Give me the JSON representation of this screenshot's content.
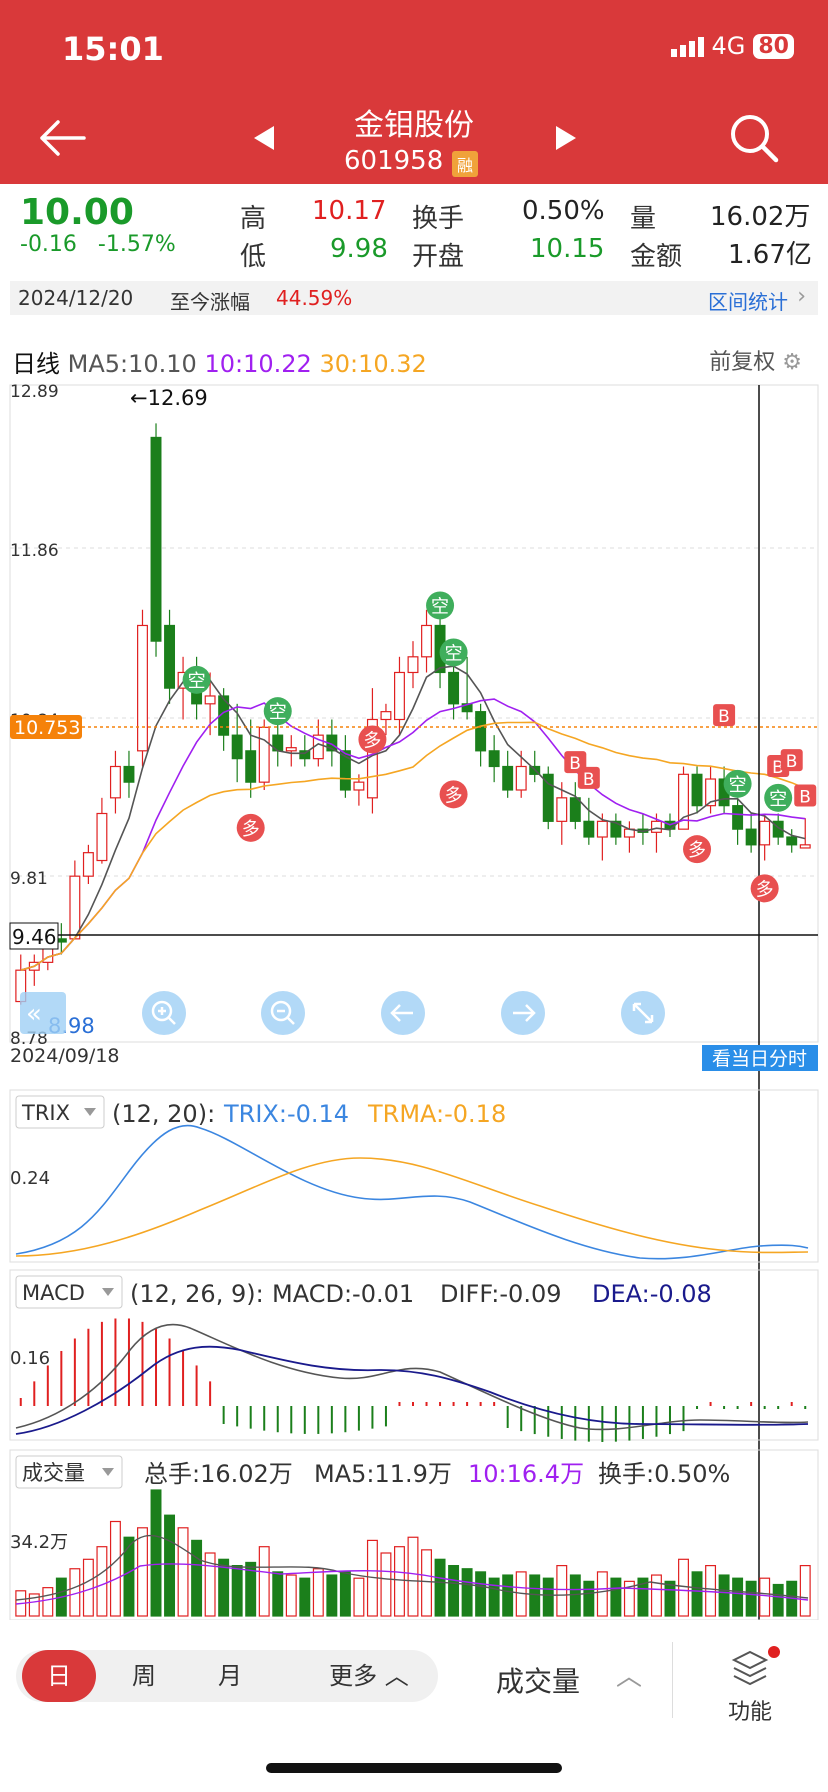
{
  "status": {
    "time": "15:01",
    "network": "4G",
    "battery": "80"
  },
  "header": {
    "name": "金钼股份",
    "code": "601958",
    "rong": "融"
  },
  "quote": {
    "price": "10.00",
    "change": "-0.16",
    "change_pct": "-1.57%",
    "high_label": "高",
    "high": "10.17",
    "low_label": "低",
    "low": "9.98",
    "turnover_label": "换手",
    "turnover": "0.50%",
    "open_label": "开盘",
    "open": "10.15",
    "vol_label": "量",
    "vol": "16.02万",
    "amount_label": "金额",
    "amount": "1.67亿"
  },
  "datebar": {
    "date": "2024/12/20",
    "since_label": "至今涨幅",
    "since_value": "44.59%",
    "range_stats": "区间统计"
  },
  "kline": {
    "title": "日线",
    "ma5": "MA5:10.10",
    "ma10": "10:10.22",
    "ma30": "30:10.32",
    "fq_label": "前复权",
    "y_labels": [
      "12.89",
      "11.86",
      "10.84",
      "9.81",
      "8.78"
    ],
    "price_tag": "10.753",
    "cross_tag": "9.46",
    "max_label": "←12.69",
    "min_label": "8.98",
    "start_date": "2024/09/18",
    "fenshi_button": "看当日分时",
    "marker_kong": "空",
    "marker_duo": "多",
    "marker_b": "B"
  },
  "trix": {
    "name": "TRIX",
    "params": "(12, 20):",
    "trix": "TRIX:-0.14",
    "trma": "TRMA:-0.18",
    "y_label": "0.24"
  },
  "macd": {
    "name": "MACD",
    "params": "(12, 26, 9):",
    "macd": "MACD:-0.01",
    "diff": "DIFF:-0.09",
    "dea": "DEA:-0.08",
    "y_label": "0.16"
  },
  "volume": {
    "name": "成交量",
    "total": "总手:16.02万",
    "ma5": "MA5:11.9万",
    "ma10": "10:16.4万",
    "turnover": "换手:0.50%",
    "y_label": "34.2万"
  },
  "colors": {
    "up": "#e02020",
    "down": "#1b7f1b",
    "ma5": "#555555",
    "ma10": "#a020f0",
    "ma30": "#f5a623",
    "brand": "#d9393a"
  },
  "chart_data": {
    "type": "candlestick",
    "x_range": [
      "2024/09/18",
      "2024/12/20"
    ],
    "ylim": [
      8.78,
      12.89
    ],
    "ohlc": [
      [
        9.0,
        9.3,
        8.98,
        9.2
      ],
      [
        9.2,
        9.3,
        9.1,
        9.25
      ],
      [
        9.25,
        9.5,
        9.2,
        9.4
      ],
      [
        9.4,
        9.5,
        9.3,
        9.38
      ],
      [
        9.4,
        9.9,
        9.4,
        9.8
      ],
      [
        9.8,
        10.0,
        9.75,
        9.95
      ],
      [
        9.9,
        10.3,
        9.88,
        10.2
      ],
      [
        10.3,
        10.6,
        10.2,
        10.5
      ],
      [
        10.5,
        10.6,
        10.3,
        10.4
      ],
      [
        10.6,
        11.5,
        10.5,
        11.4
      ],
      [
        12.6,
        12.69,
        11.2,
        11.3
      ],
      [
        11.4,
        11.5,
        10.9,
        11.0
      ],
      [
        11.0,
        11.2,
        10.8,
        11.1
      ],
      [
        11.1,
        11.2,
        10.8,
        10.9
      ],
      [
        10.9,
        11.1,
        10.7,
        10.95
      ],
      [
        10.95,
        11.0,
        10.6,
        10.7
      ],
      [
        10.7,
        10.9,
        10.4,
        10.55
      ],
      [
        10.6,
        10.8,
        10.3,
        10.4
      ],
      [
        10.4,
        10.8,
        10.35,
        10.75
      ],
      [
        10.7,
        10.8,
        10.5,
        10.6
      ],
      [
        10.6,
        10.7,
        10.5,
        10.62
      ],
      [
        10.6,
        10.7,
        10.5,
        10.55
      ],
      [
        10.55,
        10.8,
        10.5,
        10.7
      ],
      [
        10.7,
        10.8,
        10.5,
        10.6
      ],
      [
        10.6,
        10.7,
        10.3,
        10.35
      ],
      [
        10.35,
        10.45,
        10.25,
        10.4
      ],
      [
        10.3,
        11.0,
        10.2,
        10.8
      ],
      [
        10.8,
        10.9,
        10.7,
        10.85
      ],
      [
        10.8,
        11.2,
        10.7,
        11.1
      ],
      [
        11.1,
        11.3,
        11.0,
        11.2
      ],
      [
        11.2,
        11.5,
        11.1,
        11.4
      ],
      [
        11.4,
        11.5,
        11.0,
        11.1
      ],
      [
        11.1,
        11.2,
        10.8,
        10.9
      ],
      [
        10.9,
        11.2,
        10.8,
        10.85
      ],
      [
        10.85,
        10.9,
        10.5,
        10.6
      ],
      [
        10.6,
        10.7,
        10.4,
        10.5
      ],
      [
        10.5,
        10.6,
        10.3,
        10.35
      ],
      [
        10.35,
        10.6,
        10.3,
        10.5
      ],
      [
        10.5,
        10.6,
        10.4,
        10.45
      ],
      [
        10.45,
        10.5,
        10.1,
        10.15
      ],
      [
        10.15,
        10.4,
        10.0,
        10.3
      ],
      [
        10.3,
        10.4,
        10.1,
        10.15
      ],
      [
        10.15,
        10.3,
        10.0,
        10.05
      ],
      [
        10.05,
        10.2,
        9.9,
        10.15
      ],
      [
        10.15,
        10.2,
        10.0,
        10.05
      ],
      [
        10.05,
        10.15,
        9.95,
        10.1
      ],
      [
        10.1,
        10.2,
        10.0,
        10.08
      ],
      [
        10.08,
        10.2,
        9.95,
        10.15
      ],
      [
        10.15,
        10.2,
        10.05,
        10.1
      ],
      [
        10.1,
        10.5,
        10.1,
        10.45
      ],
      [
        10.45,
        10.5,
        10.2,
        10.25
      ],
      [
        10.25,
        10.5,
        10.2,
        10.42
      ],
      [
        10.42,
        10.5,
        10.2,
        10.25
      ],
      [
        10.25,
        10.3,
        10.0,
        10.1
      ],
      [
        10.1,
        10.2,
        9.95,
        10.0
      ],
      [
        10.0,
        10.2,
        9.9,
        10.15
      ],
      [
        10.15,
        10.2,
        10.0,
        10.05
      ],
      [
        10.05,
        10.1,
        9.95,
        10.0
      ],
      [
        9.98,
        10.17,
        9.98,
        10.0
      ]
    ],
    "volume": [
      8,
      7,
      9,
      12,
      15,
      18,
      22,
      30,
      25,
      28,
      40,
      32,
      28,
      24,
      20,
      18,
      16,
      17,
      22,
      14,
      13,
      12,
      15,
      13,
      14,
      12,
      24,
      20,
      22,
      25,
      21,
      18,
      16,
      15,
      14,
      12,
      13,
      14,
      13,
      12,
      16,
      13,
      11,
      14,
      12,
      11,
      12,
      13,
      11,
      18,
      14,
      16,
      13,
      12,
      11,
      12,
      10,
      11,
      16
    ]
  }
}
